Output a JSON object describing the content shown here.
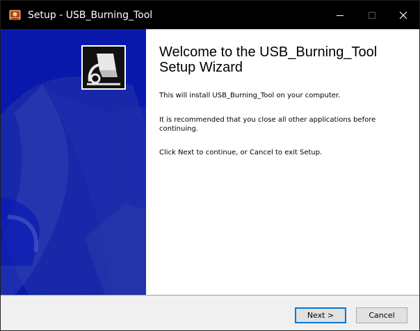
{
  "window": {
    "title": "Setup - USB_Burning_Tool",
    "minimize_icon": "minimize-icon",
    "maximize_icon": "maximize-icon",
    "close_icon": "close-icon"
  },
  "sidebar": {
    "logo_icon": "usb-burning-tool-logo-icon"
  },
  "content": {
    "heading": "Welcome to the USB_Burning_Tool Setup Wizard",
    "paragraph_1": "This will install USB_Burning_Tool on your computer.",
    "paragraph_2": "It is recommended that you close all other applications before continuing.",
    "paragraph_3": "Click Next to continue, or Cancel to exit Setup."
  },
  "buttons": {
    "next_label": "Next >",
    "cancel_label": "Cancel"
  },
  "colors": {
    "titlebar": "#000000",
    "sidebar": "#0a1ab4",
    "footer": "#f0f0f0",
    "focus_border": "#0078d7"
  }
}
